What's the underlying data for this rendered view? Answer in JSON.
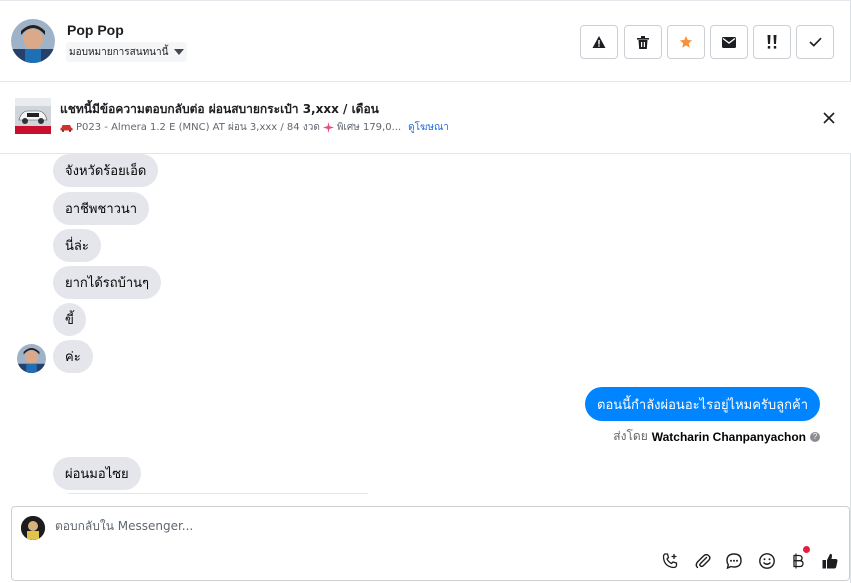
{
  "header": {
    "contact_name": "Pop Pop",
    "assign_label": "มอบหมายการสนทนานี้",
    "actions": [
      {
        "name": "report-button",
        "icon": "warning-icon"
      },
      {
        "name": "delete-button",
        "icon": "trash-icon"
      },
      {
        "name": "star-button",
        "icon": "star-icon"
      },
      {
        "name": "mark-unread-button",
        "icon": "envelope-icon"
      },
      {
        "name": "follow-up-button",
        "icon": "double-exclaim-icon"
      },
      {
        "name": "mark-done-button",
        "icon": "checkmark-icon"
      }
    ]
  },
  "ad_context": {
    "title": "แชทนี้มีข้อความตอบกลับต่อ ผ่อนสบายกระเป๋า 3,xxx / เดือน",
    "subtitle": "P023 - Almera 1.2 E (MNC) AT ผ่อน 3,xxx / 84 งวด",
    "subtitle_extra": "พิเศษ 179,0...",
    "link": "ดูโฆษณา"
  },
  "messages": {
    "incoming": [
      "จังหวัดร้อยเอ็ด",
      "อาชีพชาวนา",
      "นี่ล่ะ",
      "ยากได้รถบ้านๆ",
      "ขี้",
      "ค่ะ"
    ],
    "outgoing": "ตอนนี้กำลังผ่อนอะไรอยู่ไหมครับลูกค้า",
    "sent_by_prefix": "ส่งโดย",
    "sent_by_name": "Watcharin Chanpanyachon",
    "help_mark": "?",
    "incoming_after": "ผ่อนมอไซย"
  },
  "composer": {
    "placeholder": "ตอบกลับใน Messenger...",
    "tools": [
      "call-plus-icon",
      "paperclip-icon",
      "chat-bubble-icon",
      "smiley-icon",
      "baht-icon",
      "thumbs-up-icon"
    ]
  },
  "colors": {
    "accent": "#0084ff",
    "star": "#f7923b",
    "notification_dot": "#e41e3f"
  }
}
